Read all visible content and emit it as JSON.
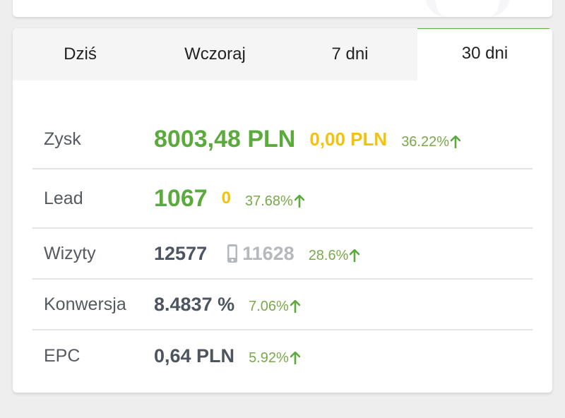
{
  "tabs": [
    {
      "label": "Dziś",
      "active": false
    },
    {
      "label": "Wczoraj",
      "active": false
    },
    {
      "label": "7 dni",
      "active": false
    },
    {
      "label": "30 dni",
      "active": true
    }
  ],
  "stats": {
    "profit": {
      "label": "Zysk",
      "value": "8003,48 PLN",
      "secondary": "0,00 PLN",
      "change": "36.22%"
    },
    "lead": {
      "label": "Lead",
      "value": "1067",
      "secondary": "0",
      "change": "37.68%"
    },
    "visits": {
      "label": "Wizyty",
      "value": "12577",
      "mobile": "11628",
      "change": "28.6%"
    },
    "conversion": {
      "label": "Konwersja",
      "value": "8.4837 %",
      "change": "7.06%"
    },
    "epc": {
      "label": "EPC",
      "value": "0,64 PLN",
      "change": "5.92%"
    }
  },
  "icons": {
    "change": "arrow-up-icon",
    "mobile": "phone-icon"
  },
  "colors": {
    "accent": "#5db043",
    "primary_value": "#5aaa3c",
    "secondary_value": "#f4c20d",
    "change": "#7aa84a"
  }
}
